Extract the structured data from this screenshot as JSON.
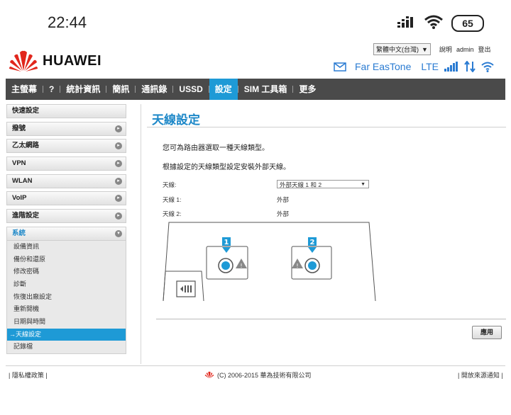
{
  "status_bar": {
    "time": "22:44",
    "battery": "65"
  },
  "top_links": {
    "language": "繁體中文(台灣)",
    "help": "說明",
    "user": "admin",
    "logout": "登出"
  },
  "header": {
    "brand": "HUAWEI",
    "operator": "Far EasTone",
    "network": "LTE"
  },
  "nav": [
    {
      "label": "主螢幕",
      "active": false
    },
    {
      "label": "?",
      "active": false
    },
    {
      "label": "統計資訊",
      "active": false
    },
    {
      "label": "簡訊",
      "active": false
    },
    {
      "label": "通訊錄",
      "active": false
    },
    {
      "label": "USSD",
      "active": false
    },
    {
      "label": "設定",
      "active": true
    },
    {
      "label": "SIM 工具箱",
      "active": false
    },
    {
      "label": "更多",
      "active": false
    }
  ],
  "sidebar": {
    "items": [
      {
        "label": "快速設定"
      },
      {
        "label": "撥號"
      },
      {
        "label": "乙太網路"
      },
      {
        "label": "VPN"
      },
      {
        "label": "WLAN"
      },
      {
        "label": "VoIP"
      },
      {
        "label": "進階設定"
      },
      {
        "label": "系統"
      }
    ],
    "system_sub": [
      {
        "label": "設備資訊"
      },
      {
        "label": "備份和還原"
      },
      {
        "label": "修改密碼"
      },
      {
        "label": "診斷"
      },
      {
        "label": "恢復出廠設定"
      },
      {
        "label": "重新開機"
      },
      {
        "label": "日期與時間"
      },
      {
        "label": "→天線設定"
      },
      {
        "label": "記錄檔"
      }
    ]
  },
  "main": {
    "title": "天線設定",
    "desc1": "您可為路由器選取一種天線類型。",
    "desc2": "根據設定的天線類型設定安裝外部天線。",
    "fields": {
      "antenna_label": "天線:",
      "antenna_value": "外部天線 1 和 2",
      "antenna1_label": "天線 1:",
      "antenna1_value": "外部",
      "antenna2_label": "天線 2:",
      "antenna2_value": "外部"
    },
    "diagram": {
      "port1": "1",
      "port2": "2"
    },
    "apply": "應用"
  },
  "footer": {
    "privacy": "| 隱私權政策 |",
    "copyright": "(C) 2006-2015 華為技術有限公司",
    "open_source": "| 開放來源通知 |"
  },
  "colors": {
    "accent": "#1e9ad6",
    "nav_bg": "#4a4a4a",
    "brand_red": "#e1261c"
  }
}
